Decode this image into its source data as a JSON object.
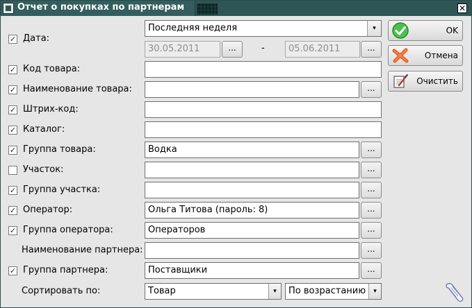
{
  "window": {
    "title": "Отчет о покупках по партнерам",
    "close": "✕"
  },
  "date": {
    "label": "Дата:",
    "checked": true,
    "period": "Последняя неделя",
    "from": "30.05.2011",
    "to": "05.06.2011",
    "dash": "-",
    "browse": "..."
  },
  "fields": [
    {
      "label": "Код товара:",
      "checked": true,
      "value": ""
    },
    {
      "label": "Наименование товара:",
      "checked": true,
      "value": "",
      "browse": "..."
    },
    {
      "label": "Штрих-код:",
      "checked": true,
      "value": ""
    },
    {
      "label": "Каталог:",
      "checked": true,
      "value": ""
    },
    {
      "label": "Группа товара:",
      "checked": true,
      "value": "Водка",
      "browse": "..."
    },
    {
      "label": "Участок:",
      "checked": false,
      "value": "",
      "browse": "..."
    },
    {
      "label": "Группа участка:",
      "checked": true,
      "value": "",
      "browse": "..."
    },
    {
      "label": "Оператор:",
      "checked": true,
      "value": "Ольга Титова (пароль: 8)",
      "browse": "..."
    },
    {
      "label": "Группа оператора:",
      "checked": true,
      "value": "Операторов",
      "browse": "..."
    },
    {
      "label": "Наименование партнера:",
      "value": "",
      "browse": "..."
    },
    {
      "label": "Группа партнера:",
      "checked": true,
      "value": "Поставщики",
      "browse": "..."
    }
  ],
  "sort": {
    "label": "Сортировать по:",
    "field": "Товар",
    "order": "По возрастанию"
  },
  "buttons": {
    "ok": "OK",
    "cancel": "Отмена",
    "clear": "Очистить"
  },
  "checkmark": "✓",
  "arrow": "▾",
  "colors": {
    "titlebar": "#2f5656",
    "dialog_bg": "#e6e6e6",
    "ok_icon": "#3bb43b",
    "cancel_icon": "#e8541c"
  }
}
